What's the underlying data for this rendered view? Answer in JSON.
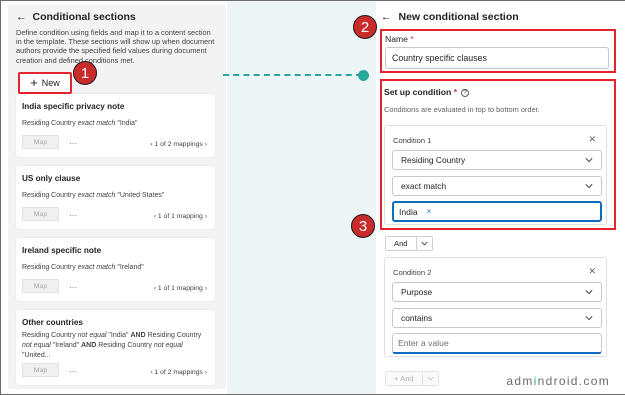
{
  "left_panel": {
    "back_icon": "arrow-left-icon",
    "title": "Conditional sections",
    "description": "Define condition using fields and map it to a content section in the template. These sections will show up when document authors provide the specified field values during document creation and defined conditions ",
    "description_tail": "met.",
    "new_button": {
      "icon": "plus-icon",
      "label": "New"
    },
    "cards": [
      {
        "title": "India specific privacy note",
        "desc_parts": [
          "Residing Country ",
          "exact match",
          " \"India\""
        ],
        "map_label": "Map",
        "more": "···",
        "pager": "1 of 2 mappings"
      },
      {
        "title": "US only clause",
        "desc_parts": [
          "Residing Country ",
          "exact match",
          " \"United States\""
        ],
        "map_label": "Map",
        "more": "···",
        "pager": "1 of 1 mapping"
      },
      {
        "title": "Ireland specific note",
        "desc_parts": [
          "Residing Country ",
          "exact match",
          " \"Ireland\""
        ],
        "map_label": "Map",
        "more": "···",
        "pager": "1 of 1 mapping"
      },
      {
        "title": "Other countries",
        "desc_parts": [
          "Residing Country ",
          "not equal",
          " \"India\" ",
          "AND",
          " Residing Country ",
          "not equal",
          " \"Ireland\" ",
          "AND",
          " Residing Country ",
          "not equal",
          " \"United..."
        ],
        "map_label": "Map",
        "more": "···",
        "pager": "1 of 2 mappings"
      }
    ]
  },
  "right_panel": {
    "back_icon": "arrow-left-icon",
    "title": "New conditional section",
    "name_label": "Name",
    "required_mark": "*",
    "name_value": "Country specific clauses",
    "setup_label": "Set up condition",
    "setup_info_icon": "info-icon",
    "setup_subtitle": "Conditions are evaluated in top to bottom order.",
    "condition1": {
      "title": "Condition 1",
      "field": "Residing Country",
      "operator": "exact match",
      "value_tag": "India",
      "tag_remove": "×"
    },
    "and_label": "And",
    "condition2": {
      "title": "Condition 2",
      "field": "Purpose",
      "operator": "contains",
      "value_placeholder": "Enter a value"
    },
    "add_and_label": "+ And"
  },
  "annotations": {
    "badges": [
      "1",
      "2",
      "3"
    ],
    "highlight_color": "#e3242b",
    "connector_color": "#2aa79b"
  },
  "watermark": {
    "prefix": "adm",
    "o": "i",
    "suffix": "ndroid.com",
    "full": "admindroid.com"
  },
  "colors": {
    "accent": "#0f6cbd",
    "required": "#c4314b",
    "badge": "#c92b2b"
  }
}
